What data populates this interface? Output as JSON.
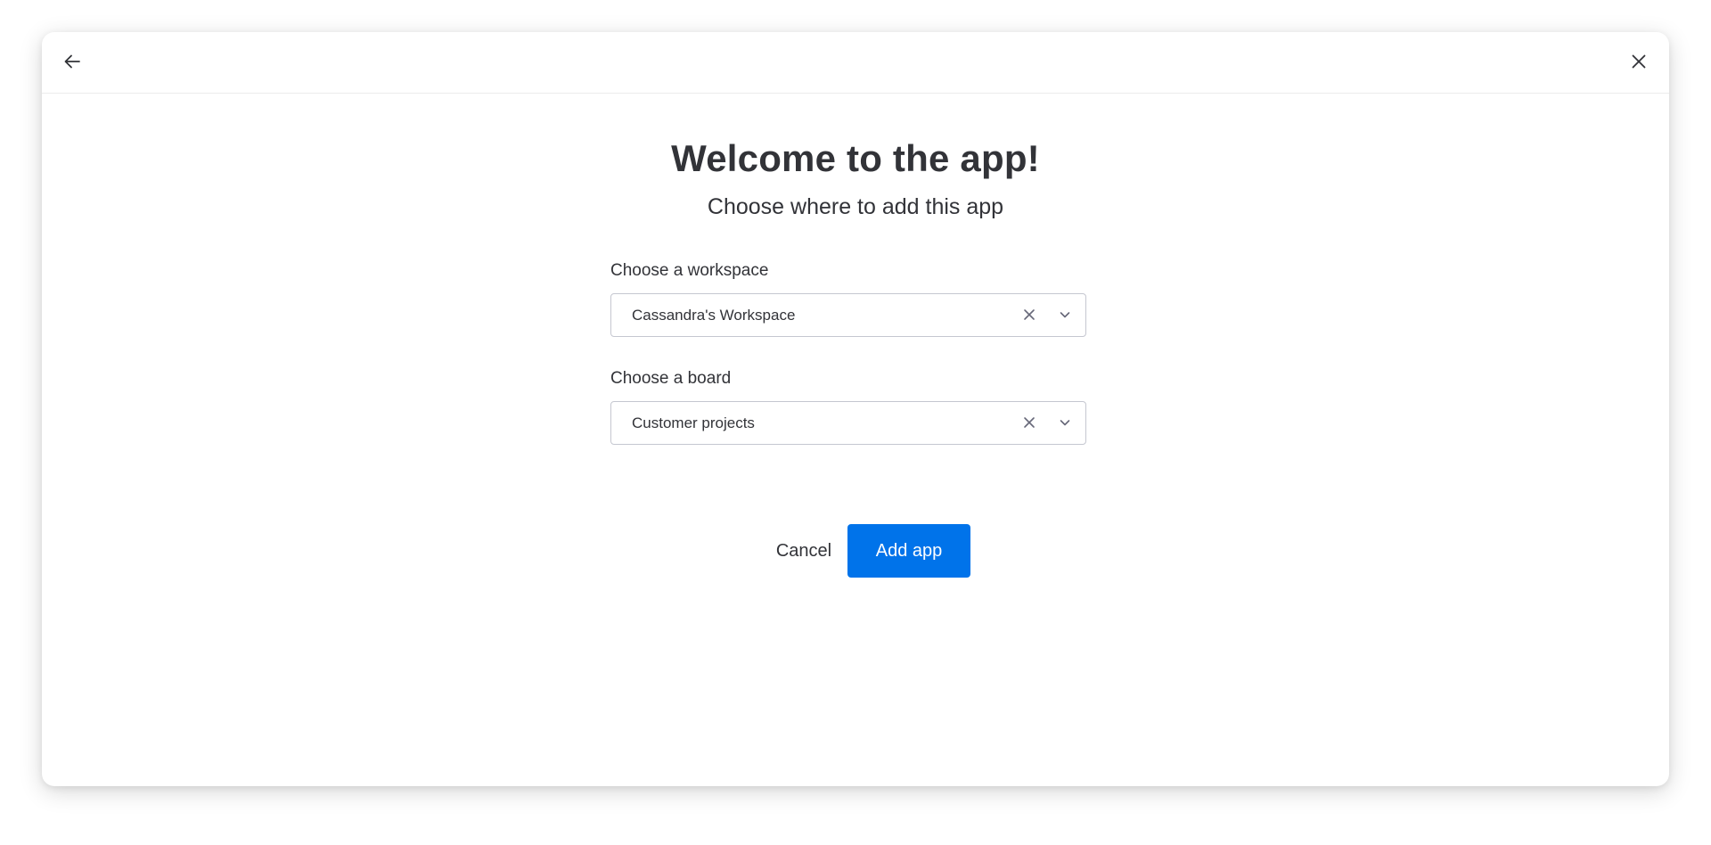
{
  "header": {
    "back_icon": "arrow-left-icon",
    "close_icon": "close-icon"
  },
  "title": "Welcome to the app!",
  "subtitle": "Choose where to add this app",
  "workspace": {
    "label": "Choose a workspace",
    "value": "Cassandra's Workspace",
    "clear_icon": "clear-icon",
    "dropdown_icon": "chevron-down-icon"
  },
  "board": {
    "label": "Choose a board",
    "value": "Customer projects",
    "clear_icon": "clear-icon",
    "dropdown_icon": "chevron-down-icon"
  },
  "actions": {
    "cancel_label": "Cancel",
    "add_label": "Add app"
  },
  "colors": {
    "primary": "#0073ea",
    "text": "#323338",
    "border": "#c5c7d0"
  }
}
